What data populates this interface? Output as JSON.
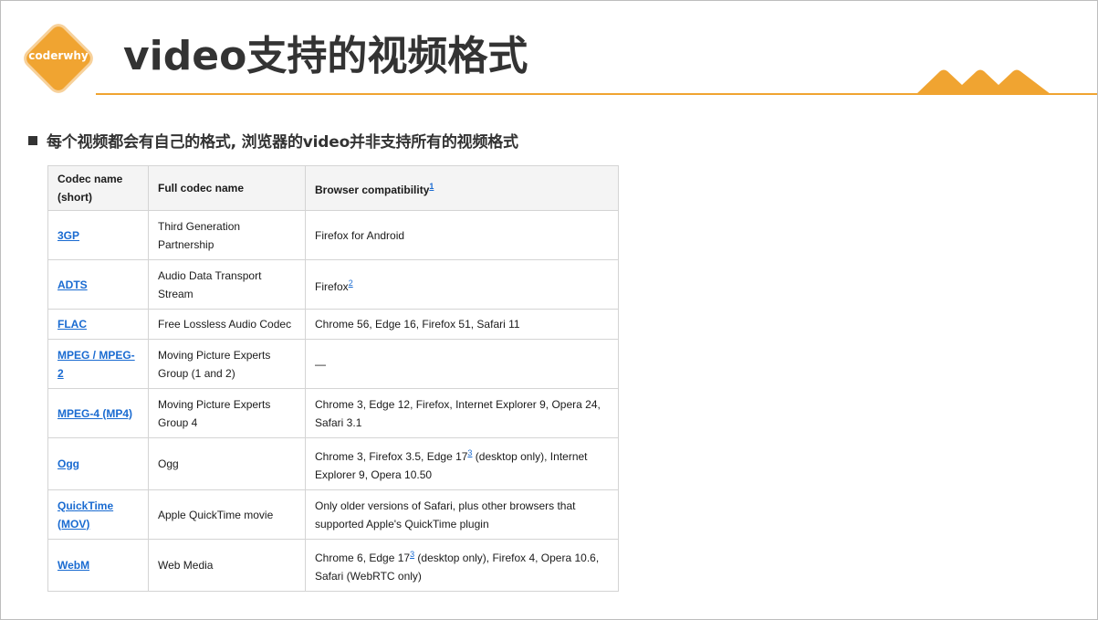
{
  "logo": {
    "text": "coderwhy"
  },
  "title": "video支持的视频格式",
  "bullet": "每个视频都会有自己的格式, 浏览器的video并非支持所有的视频格式",
  "colors": {
    "accent": "#f0a431",
    "link": "#1a6bd1",
    "text": "#333333"
  },
  "table": {
    "headers": {
      "short": "Codec name (short)",
      "full": "Full codec name",
      "compat": "Browser compatibility",
      "compat_note": "1"
    },
    "rows": [
      {
        "short": "3GP",
        "full": "Third Generation Partnership",
        "compat": "Firefox for Android"
      },
      {
        "short": "ADTS",
        "full": "Audio Data Transport Stream",
        "compat": "Firefox",
        "note": "2"
      },
      {
        "short": "FLAC",
        "full": "Free Lossless Audio Codec",
        "compat": "Chrome 56, Edge 16, Firefox 51, Safari 11"
      },
      {
        "short": "MPEG / MPEG-2",
        "full": "Moving Picture Experts Group (1 and 2)",
        "compat": "—"
      },
      {
        "short": "MPEG-4 (MP4)",
        "full": "Moving Picture Experts Group 4",
        "compat": "Chrome 3, Edge 12, Firefox, Internet Explorer 9, Opera 24, Safari 3.1"
      },
      {
        "short": "Ogg",
        "full": "Ogg",
        "compat_a": "Chrome 3, Firefox 3.5, Edge 17",
        "note": "3",
        "compat_b": " (desktop only), Internet Explorer 9, Opera 10.50"
      },
      {
        "short": "QuickTime (MOV)",
        "full": "Apple QuickTime movie",
        "compat": "Only older versions of Safari, plus other browsers that supported Apple's QuickTime plugin"
      },
      {
        "short": "WebM",
        "full": "Web Media",
        "compat_a": "Chrome 6, Edge 17",
        "note": "3",
        "compat_b": " (desktop only), Firefox 4, Opera 10.6, Safari (WebRTC only)"
      }
    ]
  }
}
